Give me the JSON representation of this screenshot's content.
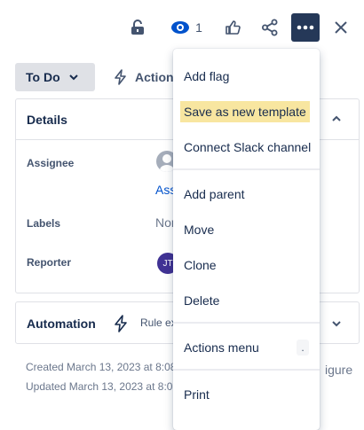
{
  "toolbar": {
    "watch_count": "1"
  },
  "status": {
    "label": "To Do"
  },
  "actions": {
    "label": "Actions"
  },
  "details": {
    "title": "Details",
    "assignee_label": "Assignee",
    "assignee_link": "Ass",
    "labels_label": "Labels",
    "labels_value": "Nor",
    "reporter_label": "Reporter",
    "reporter_initials": "JT"
  },
  "automation": {
    "title": "Automation",
    "rule_text": "Rule ex"
  },
  "meta": {
    "created": "Created March 13, 2023 at 8:08",
    "updated": "Updated March 13, 2023 at 8:0",
    "configure": "igure"
  },
  "menu": {
    "items": [
      "Add flag",
      "Save as new template",
      "Connect Slack channel",
      "Add parent",
      "Move",
      "Clone",
      "Delete",
      "Actions menu",
      "Print"
    ],
    "shortcut": "."
  },
  "colors": {
    "more_button_bg": "#253858",
    "highlight": "#f8e6a0",
    "status_bg": "#dfe1e6",
    "link": "#0052cc"
  }
}
